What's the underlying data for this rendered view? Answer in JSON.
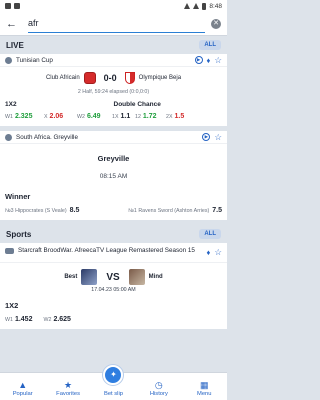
{
  "status": {
    "time": "8:48"
  },
  "search": {
    "query": "afr"
  },
  "live": {
    "title": "LIVE",
    "all_label": "ALL",
    "match": {
      "league": "Tunisian Cup",
      "home": "Club Africain",
      "away": "Olympique Beja",
      "score": "0-0",
      "elapsed": "2 Half, 59:24 elapsed (0:0,0:0)",
      "market1": "1X2",
      "market2": "Double Chance",
      "odds": [
        {
          "label": "W1",
          "value": "2.325",
          "color": "#1f9e3c"
        },
        {
          "label": "X",
          "value": "2.06",
          "color": "#d32a2a"
        },
        {
          "label": "W2",
          "value": "6.49",
          "color": "#1f9e3c"
        },
        {
          "label": "1X",
          "value": "1.1",
          "color": "#1d2330"
        },
        {
          "label": "12",
          "value": "1.72",
          "color": "#1f9e3c"
        },
        {
          "label": "2X",
          "value": "1.5",
          "color": "#d32a2a"
        }
      ]
    },
    "outright": {
      "region": "South Africa. Greyville",
      "name": "Greyville",
      "time": "08:15 AM",
      "market": "Winner",
      "runners": [
        {
          "label": "№3 Hippocrates (S Veale)",
          "value": "8.5"
        },
        {
          "label": "№1 Ravens Sword (Ashton Arries)",
          "value": "7.5"
        }
      ]
    }
  },
  "sports": {
    "title": "Sports",
    "all_label": "ALL",
    "event": {
      "league": "Starcraft BroodWar. AfreecaTV League Remastered Season 15",
      "player1": "Best",
      "player2": "Mind",
      "vs": "VS",
      "date": "17.04.23 05:00 AM",
      "market": "1X2",
      "odds": [
        {
          "label": "W1",
          "value": "1.452"
        },
        {
          "label": "W2",
          "value": "2.625"
        }
      ]
    }
  },
  "nav": {
    "items": [
      {
        "label": "Popular",
        "icon": "flame-icon"
      },
      {
        "label": "Favorites",
        "icon": "star-icon"
      },
      {
        "label": "Bet slip",
        "icon": "ticket-icon"
      },
      {
        "label": "History",
        "icon": "clock-icon"
      },
      {
        "label": "Menu",
        "icon": "grid-icon"
      }
    ]
  }
}
